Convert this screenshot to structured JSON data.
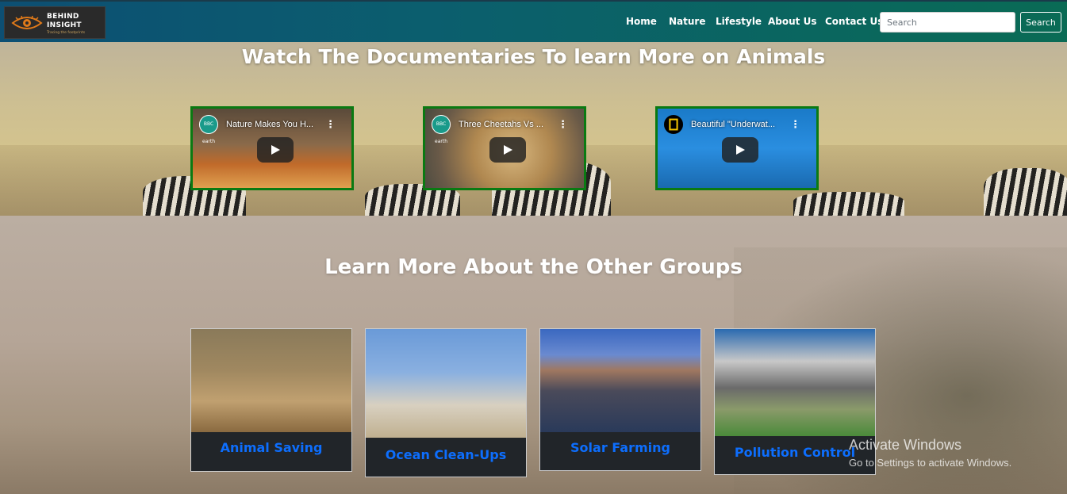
{
  "brand": {
    "name_line1": "BEHIND",
    "name_line2": "INSIGHT",
    "tagline": "Tracing the footprints"
  },
  "nav": {
    "links": [
      "Home",
      "Nature",
      "Lifestyle",
      "About Us",
      "Contact Us"
    ]
  },
  "search": {
    "placeholder": "Search",
    "button": "Search"
  },
  "hero": {
    "title": "Watch The Documentaries To learn More on Animals"
  },
  "videos": [
    {
      "title": "Nature Makes You H...",
      "channel": "BBC earth"
    },
    {
      "title": "Three Cheetahs Vs ...",
      "channel": "BBC earth"
    },
    {
      "title": "Beautiful \"Underwat...",
      "channel": ""
    }
  ],
  "groups": {
    "title": "Learn More About the Other Groups",
    "cards": [
      {
        "label": "Animal Saving"
      },
      {
        "label": "Ocean Clean-Ups"
      },
      {
        "label": "Solar Farming"
      },
      {
        "label": "Pollution Control"
      }
    ]
  },
  "watermark": {
    "line1": "Activate Windows",
    "line2": "Go to Settings to activate Windows."
  },
  "colors": {
    "link": "#0d6efd",
    "video_border": "#0a7a12",
    "card_label_bg": "#212529"
  }
}
